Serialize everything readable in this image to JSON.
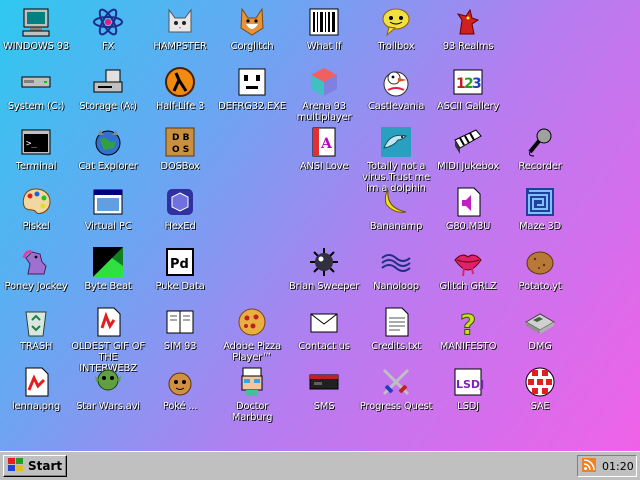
{
  "desktop": {
    "icons": [
      {
        "label": "WINDOWS 93",
        "icon": "computer-icon"
      },
      {
        "label": "FX",
        "icon": "atom-icon"
      },
      {
        "label": "HAMPSTER",
        "icon": "cat-icon"
      },
      {
        "label": "Corglitch",
        "icon": "corgi-icon"
      },
      {
        "label": "What If",
        "icon": "barcode-icon"
      },
      {
        "label": "Trollbox",
        "icon": "chat-bubble-icon"
      },
      {
        "label": "93 Realms",
        "icon": "dragon-icon"
      },
      {
        "label": "System (C:)",
        "icon": "hard-drive-icon"
      },
      {
        "label": "Storage (A:)",
        "icon": "floppy-drive-icon"
      },
      {
        "label": "Half-Life 3",
        "icon": "lambda-icon"
      },
      {
        "label": "DEFRG32.EXE",
        "icon": "face-icon"
      },
      {
        "label": "Arena 93 multiplayer",
        "icon": "cube-icon"
      },
      {
        "label": "Castlevania",
        "icon": "duck-icon"
      },
      {
        "label": "ASCII Gallery",
        "icon": "numbers-icon"
      },
      {
        "label": "Terminal",
        "icon": "terminal-icon"
      },
      {
        "label": "Cat Explorer",
        "icon": "globe-cat-icon"
      },
      {
        "label": "DOSBox",
        "icon": "dosbox-icon"
      },
      {
        "label": "ANSI Love",
        "icon": "ansi-icon"
      },
      {
        "label": "Totally not a virus.Trust me im a dolphin",
        "icon": "dolphin-icon"
      },
      {
        "label": "MIDI Jukebox",
        "icon": "piano-icon"
      },
      {
        "label": "Recorder",
        "icon": "microphone-icon"
      },
      {
        "label": "Piskel",
        "icon": "palette-icon"
      },
      {
        "label": "Virtual PC",
        "icon": "window-icon"
      },
      {
        "label": "HexEd",
        "icon": "hex-cube-icon"
      },
      {
        "label": "Bananamp",
        "icon": "banana-icon"
      },
      {
        "label": "G80.M3U",
        "icon": "speaker-file-icon"
      },
      {
        "label": "Maze 3D",
        "icon": "maze-icon"
      },
      {
        "label": "Poney Jockey",
        "icon": "pony-icon"
      },
      {
        "label": "Byte Beat",
        "icon": "beat-icon"
      },
      {
        "label": "Puke Data",
        "icon": "pd-icon"
      },
      {
        "label": "Brian Sweeper",
        "icon": "mine-icon"
      },
      {
        "label": "Nanoloop",
        "icon": "waves-icon"
      },
      {
        "label": "Glitch GRLZ",
        "icon": "lips-icon"
      },
      {
        "label": "Potato.yt",
        "icon": "potato-icon"
      },
      {
        "label": "TRASH",
        "icon": "recycle-bin-icon"
      },
      {
        "label": "OLDEST GIF OF THE INTERWEBZ",
        "icon": "gif-icon"
      },
      {
        "label": "SIM 93",
        "icon": "book-icon"
      },
      {
        "label": "Adobe Pizza Player™",
        "icon": "pizza-icon"
      },
      {
        "label": "Contact us",
        "icon": "mail-icon"
      },
      {
        "label": "Credits.txt",
        "icon": "text-file-icon"
      },
      {
        "label": "MANIFESTO",
        "icon": "question-icon"
      },
      {
        "label": "DMG",
        "icon": "gameboy-icon"
      },
      {
        "label": "lenna.png",
        "icon": "image-file-icon"
      },
      {
        "label": "Star Wars.avi",
        "icon": "video-file-icon"
      },
      {
        "label": "Poké ...",
        "icon": "pokemon-icon"
      },
      {
        "label": "Doctor Marburg",
        "icon": "doctor-icon"
      },
      {
        "label": "SMS",
        "icon": "console-icon"
      },
      {
        "label": "Progress Quest",
        "icon": "swords-icon"
      },
      {
        "label": "LSDJ",
        "icon": "lsdj-icon"
      },
      {
        "label": "SAE",
        "icon": "ball-icon"
      }
    ]
  },
  "taskbar": {
    "start_label": "Start",
    "clock": "01:20"
  },
  "colors": {
    "gradient_start": "#2ec8f0",
    "gradient_end": "#f062e8",
    "taskbar": "#c0c0c0"
  }
}
